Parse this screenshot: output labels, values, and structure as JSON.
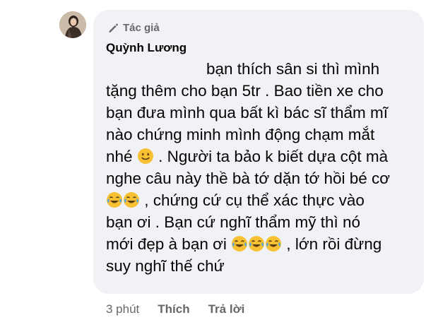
{
  "comment": {
    "author_badge": "Tác giả",
    "author_name": "Quỳnh Lương",
    "lines": [
      "bạn thích sân si thì mình",
      "tặng thêm cho bạn 5tr . Bao tiền xe cho",
      "bạn đưa mình qua bất kì bác sĩ thẩm mĩ",
      "nào chứng minh mình động chạm mắt",
      ". Người ta bảo k biết dựa cột mà",
      "nghe câu này thề bà tớ dặn tớ hồi bé cơ",
      ", chứng cứ cụ thể xác thực vào",
      "bạn ơi  . Bạn cứ nghĩ thẩm mỹ thì nó",
      ", lớn rồi đừng",
      "suy nghĩ thế chứ"
    ],
    "line5_prefix": "nhé",
    "line9_prefix": "mới đẹp à bạn ơi",
    "emoji": {
      "smile": "slightly-smiling-face",
      "laugh": "face-with-tears-of-joy"
    }
  },
  "actions": {
    "time": "3 phút",
    "like": "Thích",
    "reply": "Trả lời"
  },
  "colors": {
    "bubble": "#f0f2f5",
    "text": "#050505",
    "secondary": "#65676b",
    "emoji": "#f7c133"
  }
}
